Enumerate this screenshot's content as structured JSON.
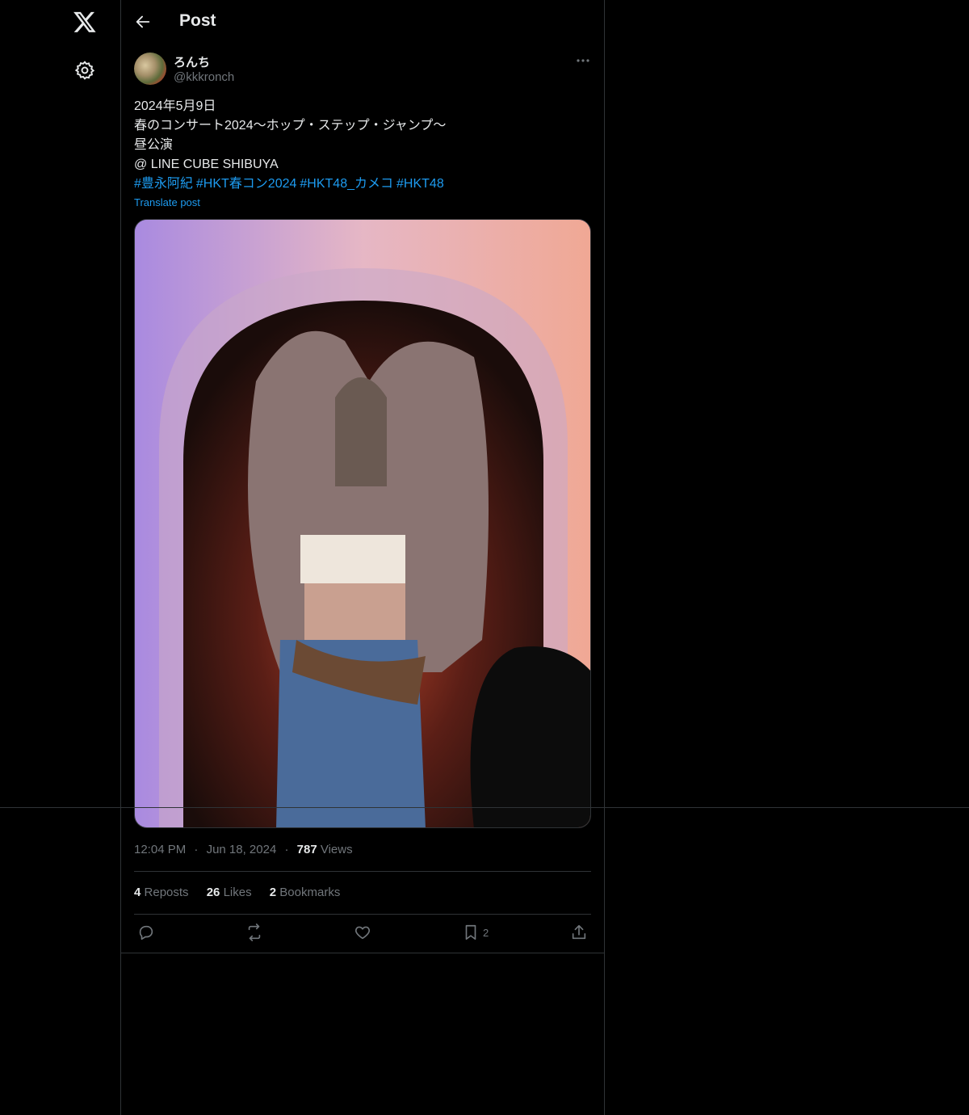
{
  "nav": {
    "logo_icon": "x-logo-icon",
    "settings_icon": "gear-icon"
  },
  "header": {
    "title": "Post",
    "back_icon": "arrow-left-icon"
  },
  "post": {
    "author_name": "ろんち",
    "author_handle": "@kkkronch",
    "more_icon": "more-horizontal-icon",
    "lines": [
      "2024年5月9日",
      "春のコンサート2024〜ホップ・ステップ・ジャンプ〜",
      "昼公演",
      "@ LINE CUBE SHIBUYA"
    ],
    "hashtags": [
      "#豊永阿紀",
      "#HKT春コン2024",
      "#HKT48_カメコ",
      "#HKT48"
    ],
    "translate_label": "Translate post",
    "time": "12:04 PM",
    "date": "Jun 18, 2024",
    "views_count": "787",
    "views_label": "Views",
    "separator": "·"
  },
  "stats": {
    "reposts_count": "4",
    "reposts_label": "Reposts",
    "likes_count": "26",
    "likes_label": "Likes",
    "bookmarks_count": "2",
    "bookmarks_label": "Bookmarks"
  },
  "actions": {
    "reply_icon": "reply-icon",
    "repost_icon": "repost-icon",
    "like_icon": "heart-icon",
    "bookmark_icon": "bookmark-icon",
    "bookmark_count": "2",
    "share_icon": "share-icon"
  },
  "colors": {
    "background": "#000000",
    "accent": "#1d9bf0",
    "muted": "#71767b",
    "border": "#2f3336"
  }
}
